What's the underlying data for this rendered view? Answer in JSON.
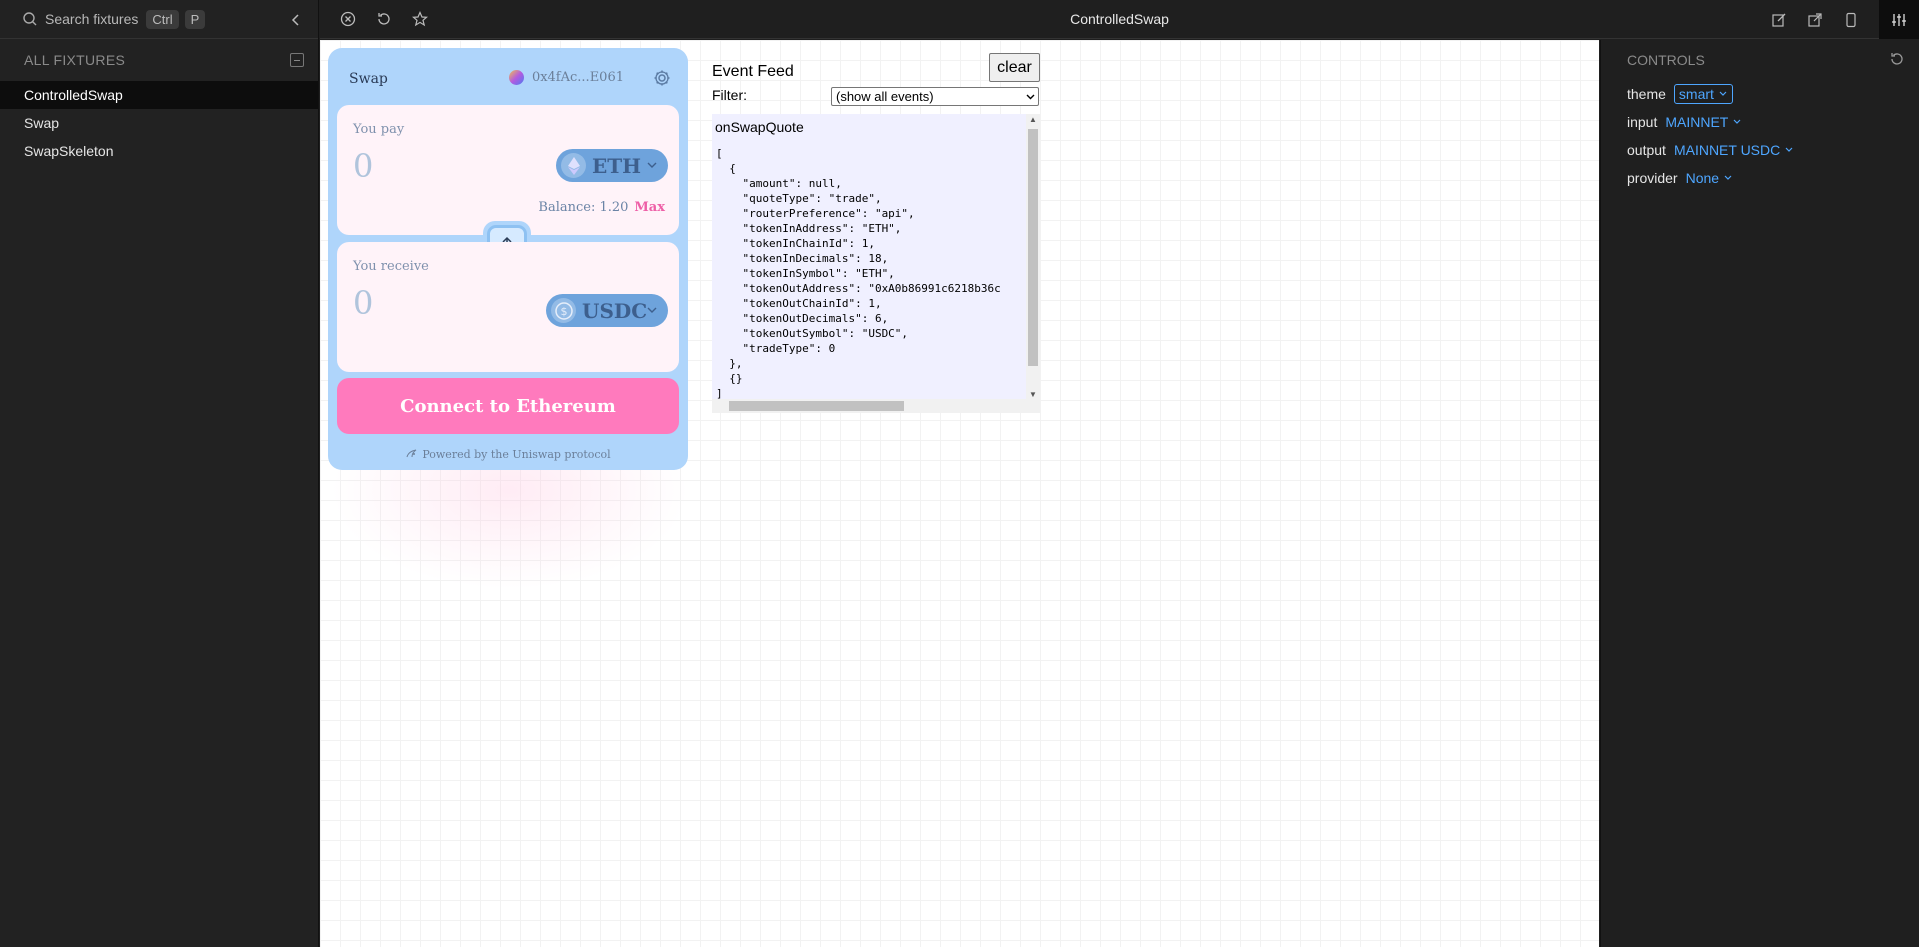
{
  "sidebar": {
    "search_placeholder": "Search fixtures",
    "shortcut_keys": [
      "Ctrl",
      "P"
    ],
    "section_title": "ALL FIXTURES",
    "items": [
      {
        "label": "ControlledSwap",
        "active": true
      },
      {
        "label": "Swap",
        "active": false
      },
      {
        "label": "SwapSkeleton",
        "active": false
      }
    ]
  },
  "topbar": {
    "title": "ControlledSwap"
  },
  "widget": {
    "title": "Swap",
    "account": "0x4fAc...E061",
    "pay": {
      "label": "You pay",
      "amount": "0",
      "token": "ETH",
      "balance": "Balance: 1.20",
      "max": "Max"
    },
    "receive": {
      "label": "You receive",
      "amount": "0",
      "token": "USDC"
    },
    "cta": "Connect to Ethereum",
    "powered_by": "Powered by the Uniswap protocol"
  },
  "event_feed": {
    "title": "Event Feed",
    "clear_label": "clear",
    "filter_label": "Filter:",
    "filter_value": "(show all events)",
    "event_name": "onSwapQuote",
    "event_body": "[\n  {\n    \"amount\": null,\n    \"quoteType\": \"trade\",\n    \"routerPreference\": \"api\",\n    \"tokenInAddress\": \"ETH\",\n    \"tokenInChainId\": 1,\n    \"tokenInDecimals\": 18,\n    \"tokenInSymbol\": \"ETH\",\n    \"tokenOutAddress\": \"0xA0b86991c6218b36c\n    \"tokenOutChainId\": 1,\n    \"tokenOutDecimals\": 6,\n    \"tokenOutSymbol\": \"USDC\",\n    \"tradeType\": 0\n  },\n  {}\n]"
  },
  "controls": {
    "title": "CONTROLS",
    "rows": [
      {
        "key": "theme",
        "value": "smart"
      },
      {
        "key": "input",
        "value": "MAINNET"
      },
      {
        "key": "output",
        "value": "MAINNET USDC"
      },
      {
        "key": "provider",
        "value": "None"
      }
    ]
  },
  "colors": {
    "accent": "#4ea6ff",
    "widget_bg": "#afd5fb",
    "cta": "#ff7abd",
    "max": "#ee5fa7"
  }
}
